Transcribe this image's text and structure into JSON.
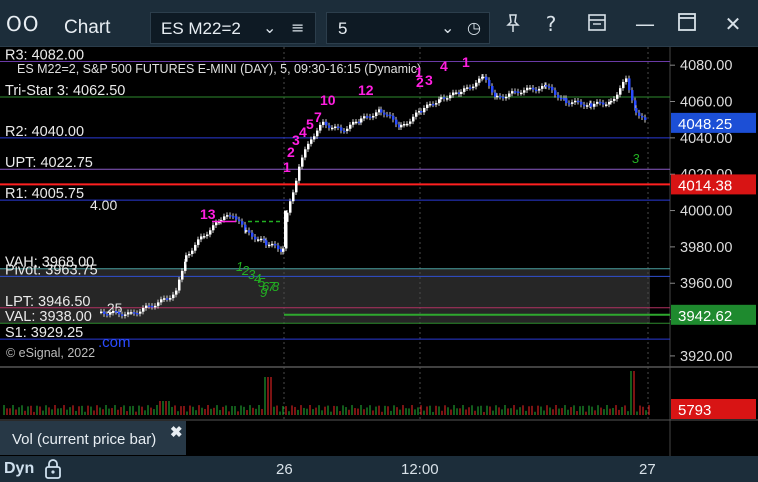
{
  "titlebar": {
    "app_icon": "OO",
    "title": "Chart",
    "symbol": "ES M22=2",
    "interval": "5",
    "icons": [
      "chevron-down-icon",
      "menu-icon",
      "clock-icon",
      "pin-icon",
      "help-icon",
      "report-icon",
      "minimize-icon",
      "maximize-icon",
      "close-icon"
    ]
  },
  "chart": {
    "header": "ES M22=2, S&P 500 FUTURES E-MINI (DAY), 5, 09:30-16:15 (Dynamic)",
    "copyright": "© eSignal, 2022",
    "levels": [
      {
        "label": "R3: 4082.00",
        "price": 4082.0,
        "color": "#6a3aa6"
      },
      {
        "label": "Tri-Star 3: 4062.50",
        "price": 4062.5,
        "color": "#2e8a2e"
      },
      {
        "label": "R2: 4040.00",
        "price": 4040.0,
        "color": "#2a3bd6"
      },
      {
        "label": "UPT: 4022.75",
        "price": 4022.75,
        "color": "#8a5ac6"
      },
      {
        "label": "R1: 4005.75",
        "price": 4005.75,
        "color": "#2a3bd6"
      },
      {
        "label": "VAH: 3968.00",
        "price": 3968.0,
        "color": "#4aa0a0"
      },
      {
        "label": "Pivot: 3963.75",
        "price": 3963.75,
        "color": "#3050d0"
      },
      {
        "label": "LPT: 3946.50",
        "price": 3946.5,
        "color": "#b03060"
      },
      {
        "label": "VAL: 3938.00",
        "price": 3938.0,
        "color": "#2e8a2e"
      },
      {
        "label": "S1: 3929.25",
        "price": 3929.25,
        "color": "#2a3bd6"
      }
    ],
    "overlay_text": [
      "4.00",
      ".25",
      ".com"
    ],
    "red_line_price": 4014.38,
    "y_axis_ticks": [
      "4080.00",
      "4060.00",
      "4040.00",
      "4020.00",
      "4000.00",
      "3980.00",
      "3960.00",
      "3940.00",
      "3920.00"
    ],
    "price_tags": [
      {
        "value": "4048.25",
        "price": 4048.25,
        "bg": "#1c4fd6"
      },
      {
        "value": "4014.38",
        "price": 4014.38,
        "bg": "#d81414"
      },
      {
        "value": "3942.62",
        "price": 3942.62,
        "bg": "#1e8a2e"
      }
    ],
    "volume_tag": {
      "value": "5793",
      "bg": "#d81414"
    },
    "volume_panel_label": "Vol (current price bar)",
    "setup_counts": {
      "magenta": [
        "1",
        "2",
        "3",
        "4",
        "5",
        "7",
        "10",
        "12",
        "13",
        "1",
        "2",
        "3",
        "4",
        "1"
      ],
      "green": [
        "1",
        "2",
        "3",
        "4",
        "5",
        "6",
        "7",
        "8",
        "9",
        "3"
      ]
    }
  },
  "statusbar": {
    "mode": "Dyn",
    "time_labels": [
      "26",
      "12:00",
      "27"
    ]
  }
}
